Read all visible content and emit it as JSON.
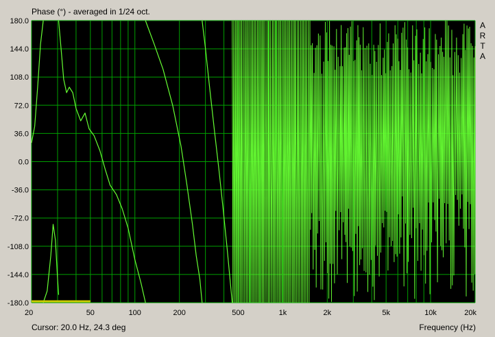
{
  "window": {
    "title": "Phase (°) - averaged in 1/24 oct.",
    "cursor_readout": "Cursor: 20.0 Hz, 24.3 deg",
    "watermark": [
      "A",
      "R",
      "T",
      "A"
    ]
  },
  "colors": {
    "plot_background": "#000000",
    "grid": "#00a000",
    "trace": "#66ff33",
    "marker": "#cccc00",
    "frame": "#d4d0c8"
  },
  "chart_data": {
    "type": "line",
    "title": "Phase (°) - averaged in 1/24 oct.",
    "xlabel": "Frequency (Hz)",
    "ylabel": "",
    "x_scale": "log",
    "xlim": [
      20,
      20000
    ],
    "ylim": [
      -180,
      180
    ],
    "grid": true,
    "x_ticks": [
      {
        "value": 20,
        "label": "20"
      },
      {
        "value": 50,
        "label": "50"
      },
      {
        "value": 100,
        "label": "100"
      },
      {
        "value": 200,
        "label": "200"
      },
      {
        "value": 500,
        "label": "500"
      },
      {
        "value": 1000,
        "label": "1k"
      },
      {
        "value": 2000,
        "label": "2k"
      },
      {
        "value": 5000,
        "label": "5k"
      },
      {
        "value": 10000,
        "label": "10k"
      },
      {
        "value": 20000,
        "label": "20k"
      }
    ],
    "y_ticks": [
      {
        "value": 180,
        "label": "180.0"
      },
      {
        "value": 144,
        "label": "144.0"
      },
      {
        "value": 108,
        "label": "108.0"
      },
      {
        "value": 72,
        "label": "72.0"
      },
      {
        "value": 36,
        "label": "36.0"
      },
      {
        "value": 0,
        "label": "0.0"
      },
      {
        "value": -36,
        "label": "-36.0"
      },
      {
        "value": -72,
        "label": "-72.0"
      },
      {
        "value": -108,
        "label": "-108.0"
      },
      {
        "value": -144,
        "label": "-144.0"
      },
      {
        "value": -180,
        "label": "-180.0"
      }
    ],
    "series": [
      {
        "segments": [
          [
            [
              20,
              24
            ],
            [
              21,
              45
            ],
            [
              22,
              95
            ],
            [
              23,
              150
            ],
            [
              24,
              180
            ]
          ],
          [
            [
              24,
              -180
            ],
            [
              25.5,
              -165
            ],
            [
              27,
              -120
            ],
            [
              28,
              -80
            ],
            [
              29,
              -100
            ],
            [
              30,
              -150
            ],
            [
              30.5,
              -170
            ]
          ],
          [
            [
              30.5,
              180
            ],
            [
              31.5,
              150
            ],
            [
              33,
              105
            ],
            [
              34.5,
              88
            ],
            [
              36,
              95
            ],
            [
              38,
              88
            ],
            [
              40,
              68
            ],
            [
              43,
              52
            ],
            [
              46,
              62
            ],
            [
              49,
              42
            ],
            [
              53,
              33
            ],
            [
              58,
              14
            ],
            [
              63,
              -10
            ],
            [
              68,
              -30
            ],
            [
              75,
              -42
            ],
            [
              82,
              -60
            ],
            [
              90,
              -85
            ],
            [
              100,
              -125
            ],
            [
              110,
              -155
            ],
            [
              118,
              -180
            ]
          ],
          [
            [
              118,
              180
            ],
            [
              135,
              150
            ],
            [
              155,
              118
            ],
            [
              180,
              72
            ],
            [
              205,
              20
            ],
            [
              225,
              -30
            ],
            [
              245,
              -80
            ],
            [
              260,
              -120
            ],
            [
              275,
              -150
            ],
            [
              285,
              -180
            ]
          ],
          [
            [
              285,
              180
            ],
            [
              300,
              145
            ],
            [
              320,
              95
            ],
            [
              345,
              40
            ],
            [
              370,
              -10
            ],
            [
              395,
              -60
            ],
            [
              420,
              -110
            ],
            [
              440,
              -150
            ],
            [
              455,
              -180
            ]
          ]
        ]
      }
    ],
    "marker_band": {
      "x_start": 20,
      "x_end": 50,
      "y": -180
    }
  }
}
